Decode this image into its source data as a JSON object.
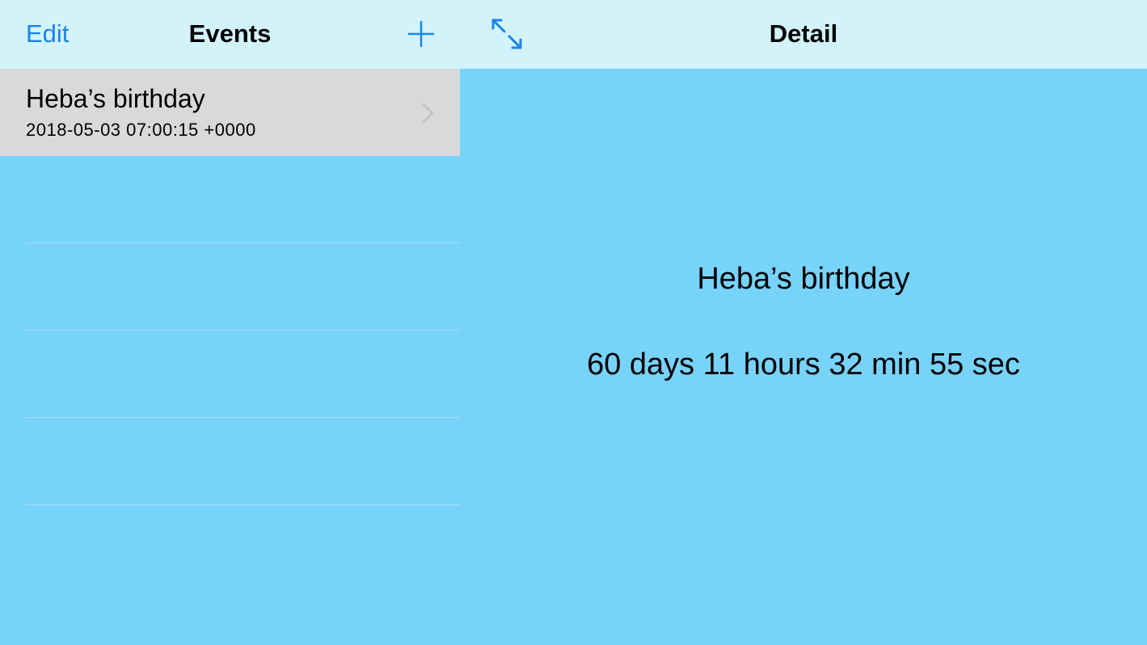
{
  "master": {
    "edit_label": "Edit",
    "title": "Events",
    "add_icon": "plus-icon",
    "events": [
      {
        "name": "Heba’s  birthday",
        "date": "2018-05-03 07:00:15 +0000"
      }
    ]
  },
  "detail": {
    "title": "Detail",
    "expand_icon": "expand-arrows-icon",
    "event_name": "Heba’s  birthday",
    "countdown": "60 days 11 hours 32 min 55 sec"
  },
  "colors": {
    "accent": "#1a84ec",
    "navbar_bg": "#d2f3fa",
    "content_bg": "#78d3fb",
    "selected_row_bg": "#d9d9d9"
  }
}
